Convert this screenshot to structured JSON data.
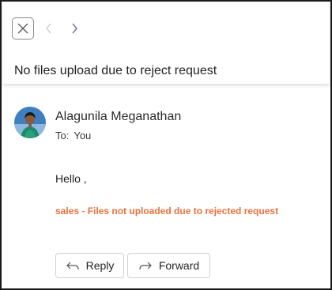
{
  "header": {
    "subject": "No files upload due to reject request"
  },
  "message": {
    "sender_name": "Alagunila Meganathan",
    "to_label": "To:",
    "to_value": "You",
    "greeting": "Hello ,",
    "alert_text": "sales - Files not uploaded due to rejected request",
    "alert_color": "#e8713a"
  },
  "actions": {
    "reply_label": "Reply",
    "forward_label": "Forward"
  },
  "icons": {
    "close": "close-icon",
    "prev": "chevron-left-icon",
    "next": "chevron-right-icon",
    "reply": "reply-arrow-icon",
    "forward": "forward-arrow-icon"
  }
}
